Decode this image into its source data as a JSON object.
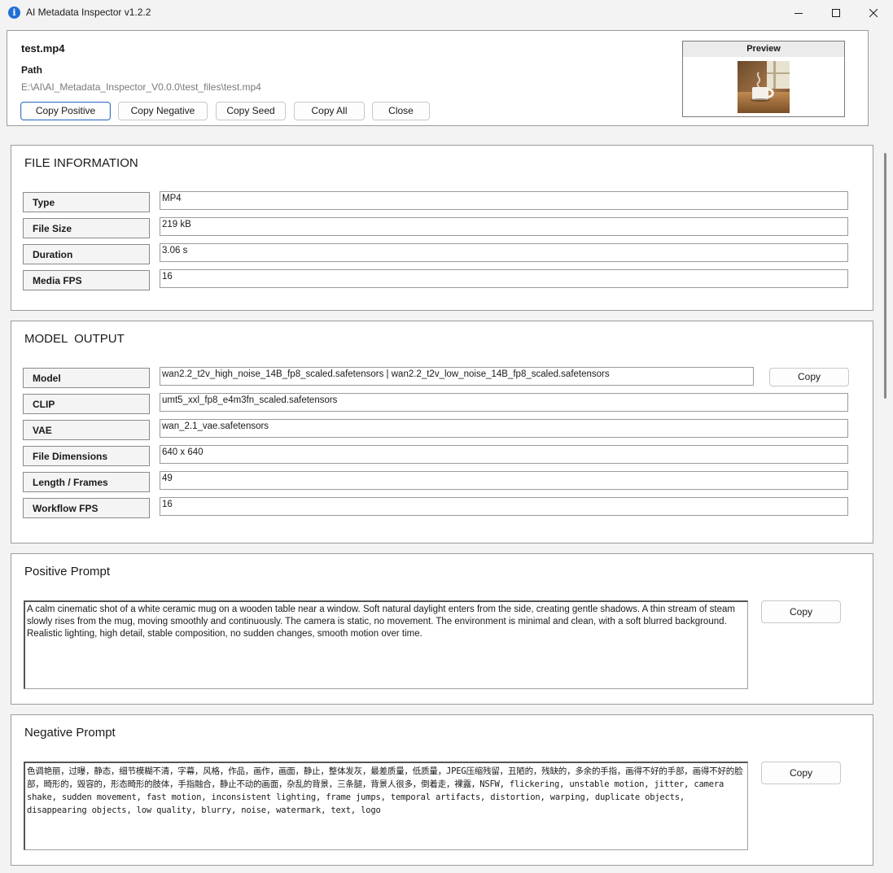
{
  "window": {
    "title": "AI Metadata Inspector v1.2.2",
    "app_icon_glyph": "i"
  },
  "header": {
    "file_name": "test.mp4",
    "path_label": "Path",
    "path_value": "E:\\AI\\AI_Metadata_Inspector_V0.0.0\\test_files\\test.mp4",
    "buttons": {
      "copy_positive": "Copy Positive",
      "copy_negative": "Copy Negative",
      "copy_seed": "Copy Seed",
      "copy_all": "Copy All",
      "close": "Close"
    },
    "preview_label": "Preview"
  },
  "file_information": {
    "title": "FILE INFORMATION",
    "rows": [
      {
        "label": "Type",
        "value": "MP4"
      },
      {
        "label": "File Size",
        "value": "219 kB"
      },
      {
        "label": "Duration",
        "value": "3.06 s"
      },
      {
        "label": "Media FPS",
        "value": "16"
      }
    ]
  },
  "model_output": {
    "title": "MODEL  OUTPUT",
    "copy_label": "Copy",
    "rows": [
      {
        "label": "Model",
        "value": "wan2.2_t2v_high_noise_14B_fp8_scaled.safetensors | wan2.2_t2v_low_noise_14B_fp8_scaled.safetensors"
      },
      {
        "label": "CLIP",
        "value": "umt5_xxl_fp8_e4m3fn_scaled.safetensors"
      },
      {
        "label": "VAE",
        "value": "wan_2.1_vae.safetensors"
      },
      {
        "label": "File Dimensions",
        "value": "640 x 640"
      },
      {
        "label": "Length / Frames",
        "value": "49"
      },
      {
        "label": "Workflow FPS",
        "value": "16"
      }
    ]
  },
  "positive_prompt": {
    "title": "Positive Prompt",
    "copy_label": "Copy",
    "text": "A calm cinematic shot of a white ceramic mug on a wooden table near a window. Soft natural daylight enters from the side, creating gentle shadows. A thin stream of steam slowly rises from the mug, moving smoothly and continuously. The camera is static, no movement. The environment is minimal and clean, with a soft blurred background. Realistic lighting, high detail, stable composition, no sudden changes, smooth motion over time."
  },
  "negative_prompt": {
    "title": "Negative Prompt",
    "copy_label": "Copy",
    "text": "色调艳丽，过曝，静态，细节模糊不清，字幕，风格，作品，画作，画面，静止，整体发灰，最差质量，低质量，JPEG压缩残留，丑陋的，残缺的，多余的手指，画得不好的手部，画得不好的脸部，畸形的，毁容的，形态畸形的肢体，手指融合，静止不动的画面，杂乱的背景，三条腿，背景人很多，倒着走，裸露，NSFW, flickering, unstable motion, jitter, camera shake, sudden movement, fast motion, inconsistent lighting, frame jumps, temporal artifacts, distortion, warping, duplicate objects, disappearing objects, low quality, blurry, noise, watermark, text, logo"
  },
  "colors": {
    "accent": "#3d74c2",
    "app_icon": "#1f6fd6",
    "window_bg": "#f3f3f3",
    "panel_bg": "#ffffff"
  },
  "icons": [
    "info-app-icon",
    "minimize-icon",
    "maximize-icon",
    "close-icon"
  ]
}
